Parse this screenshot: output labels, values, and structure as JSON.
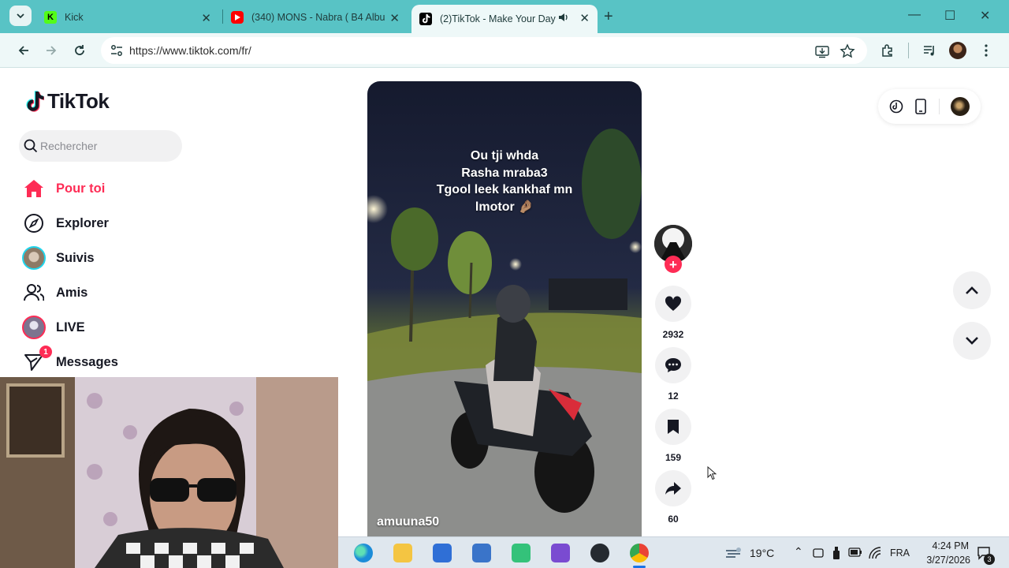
{
  "browser": {
    "tabs": [
      {
        "title": "Kick",
        "favicon": "kick-logo",
        "active": false
      },
      {
        "title": "(340) MONS - Nabra ( B4 Albu",
        "favicon": "youtube-logo",
        "active": false
      },
      {
        "title": "(2)TikTok - Make Your Day",
        "favicon": "tiktok-logo",
        "active": true,
        "audio": true
      }
    ],
    "url": "https://www.tiktok.com/fr/"
  },
  "sidebar": {
    "brand": "TikTok",
    "search_placeholder": "Rechercher",
    "nav": [
      {
        "label": "Pour toi",
        "icon": "home-icon",
        "active": true
      },
      {
        "label": "Explorer",
        "icon": "compass-icon"
      },
      {
        "label": "Suivis",
        "icon": "following-avatar"
      },
      {
        "label": "Amis",
        "icon": "friends-icon"
      },
      {
        "label": "LIVE",
        "icon": "live-avatar"
      },
      {
        "label": "Messages",
        "icon": "messages-icon",
        "badge": "1"
      }
    ]
  },
  "video": {
    "caption_lines": [
      "Ou tji whda",
      "Rasha mraba3",
      "Tgool leek kankhaf mn",
      "lmotor 🤌🏽"
    ],
    "username": "amuuna50"
  },
  "actions": {
    "likes": "2932",
    "comments": "12",
    "saves": "159",
    "shares": "60"
  },
  "taskbar": {
    "temperature": "19°C",
    "language": "FRA",
    "time": "4:24 PM",
    "date": "3/27/2026",
    "notifications": "3"
  },
  "colors": {
    "tiktok_red": "#fe2c55",
    "tiktok_cyan": "#25f4ee",
    "browser_frame": "#58c3c5"
  }
}
